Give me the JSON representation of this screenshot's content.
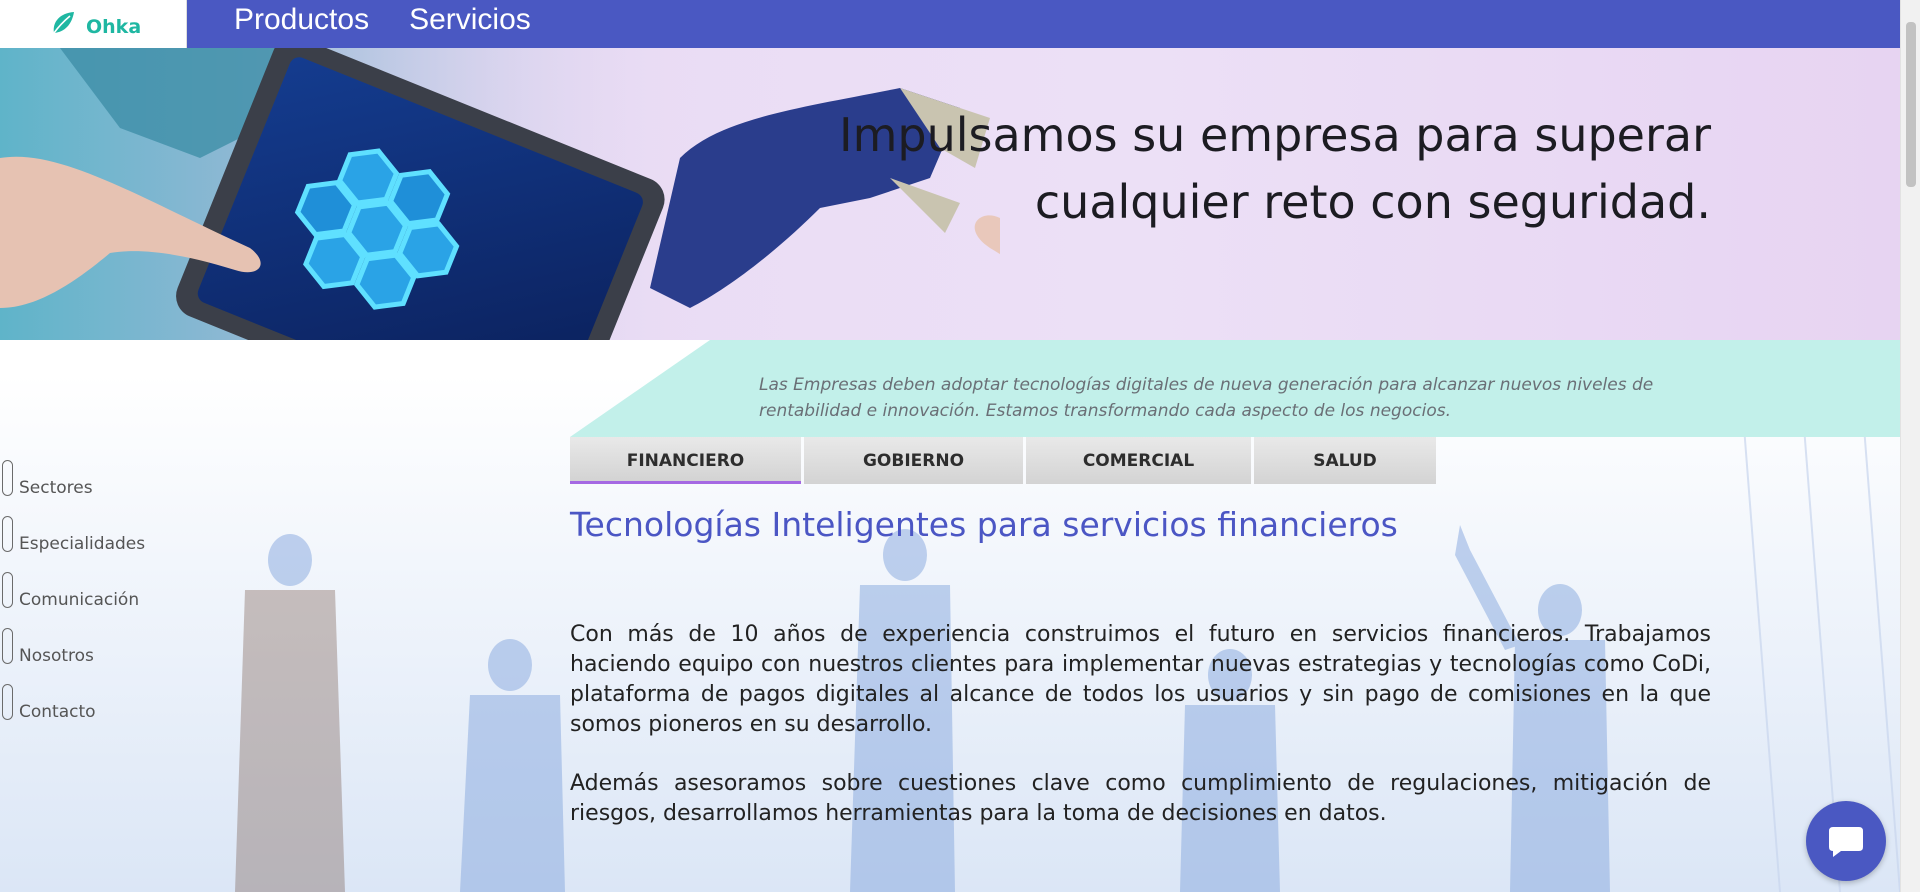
{
  "brand": {
    "name": "Ohka",
    "accent": "#4a58c2",
    "logo_color": "#1fb7a2"
  },
  "nav": {
    "items": [
      {
        "label": "Productos"
      },
      {
        "label": "Servicios"
      }
    ]
  },
  "hero": {
    "title": "Impulsamos su empresa para superar cualquier reto con seguridad."
  },
  "intro": {
    "text": "Las Empresas deben adoptar tecnologías digitales de nueva generación para alcanzar nuevos niveles de rentabilidad e innovación. Estamos transformando cada aspecto de los negocios."
  },
  "sidebar": {
    "items": [
      {
        "label": "Sectores"
      },
      {
        "label": "Especialidades"
      },
      {
        "label": "Comunicación"
      },
      {
        "label": "Nosotros"
      },
      {
        "label": "Contacto"
      }
    ]
  },
  "tabs": {
    "items": [
      {
        "label": "FINANCIERO",
        "active": true
      },
      {
        "label": "GOBIERNO",
        "active": false
      },
      {
        "label": "COMERCIAL",
        "active": false
      },
      {
        "label": "SALUD",
        "active": false
      }
    ]
  },
  "content": {
    "title": "Tecnologías Inteligentes para servicios financieros",
    "paragraphs": [
      "Con más de 10 años de experiencia construimos el futuro en servicios financieros. Trabajamos haciendo equipo con nuestros clientes para implementar nuevas estrategias y tecnologías como CoDi, plataforma de pagos digitales al alcance de todos los usuarios y sin pago de comisiones en la que somos pioneros en su desarrollo.",
      "Además asesoramos sobre cuestiones clave como cumplimiento de regulaciones, mitigación de riesgos, desarrollamos herramientas para la toma de decisiones en datos."
    ]
  },
  "chat": {
    "icon": "chat-bubble-icon"
  }
}
